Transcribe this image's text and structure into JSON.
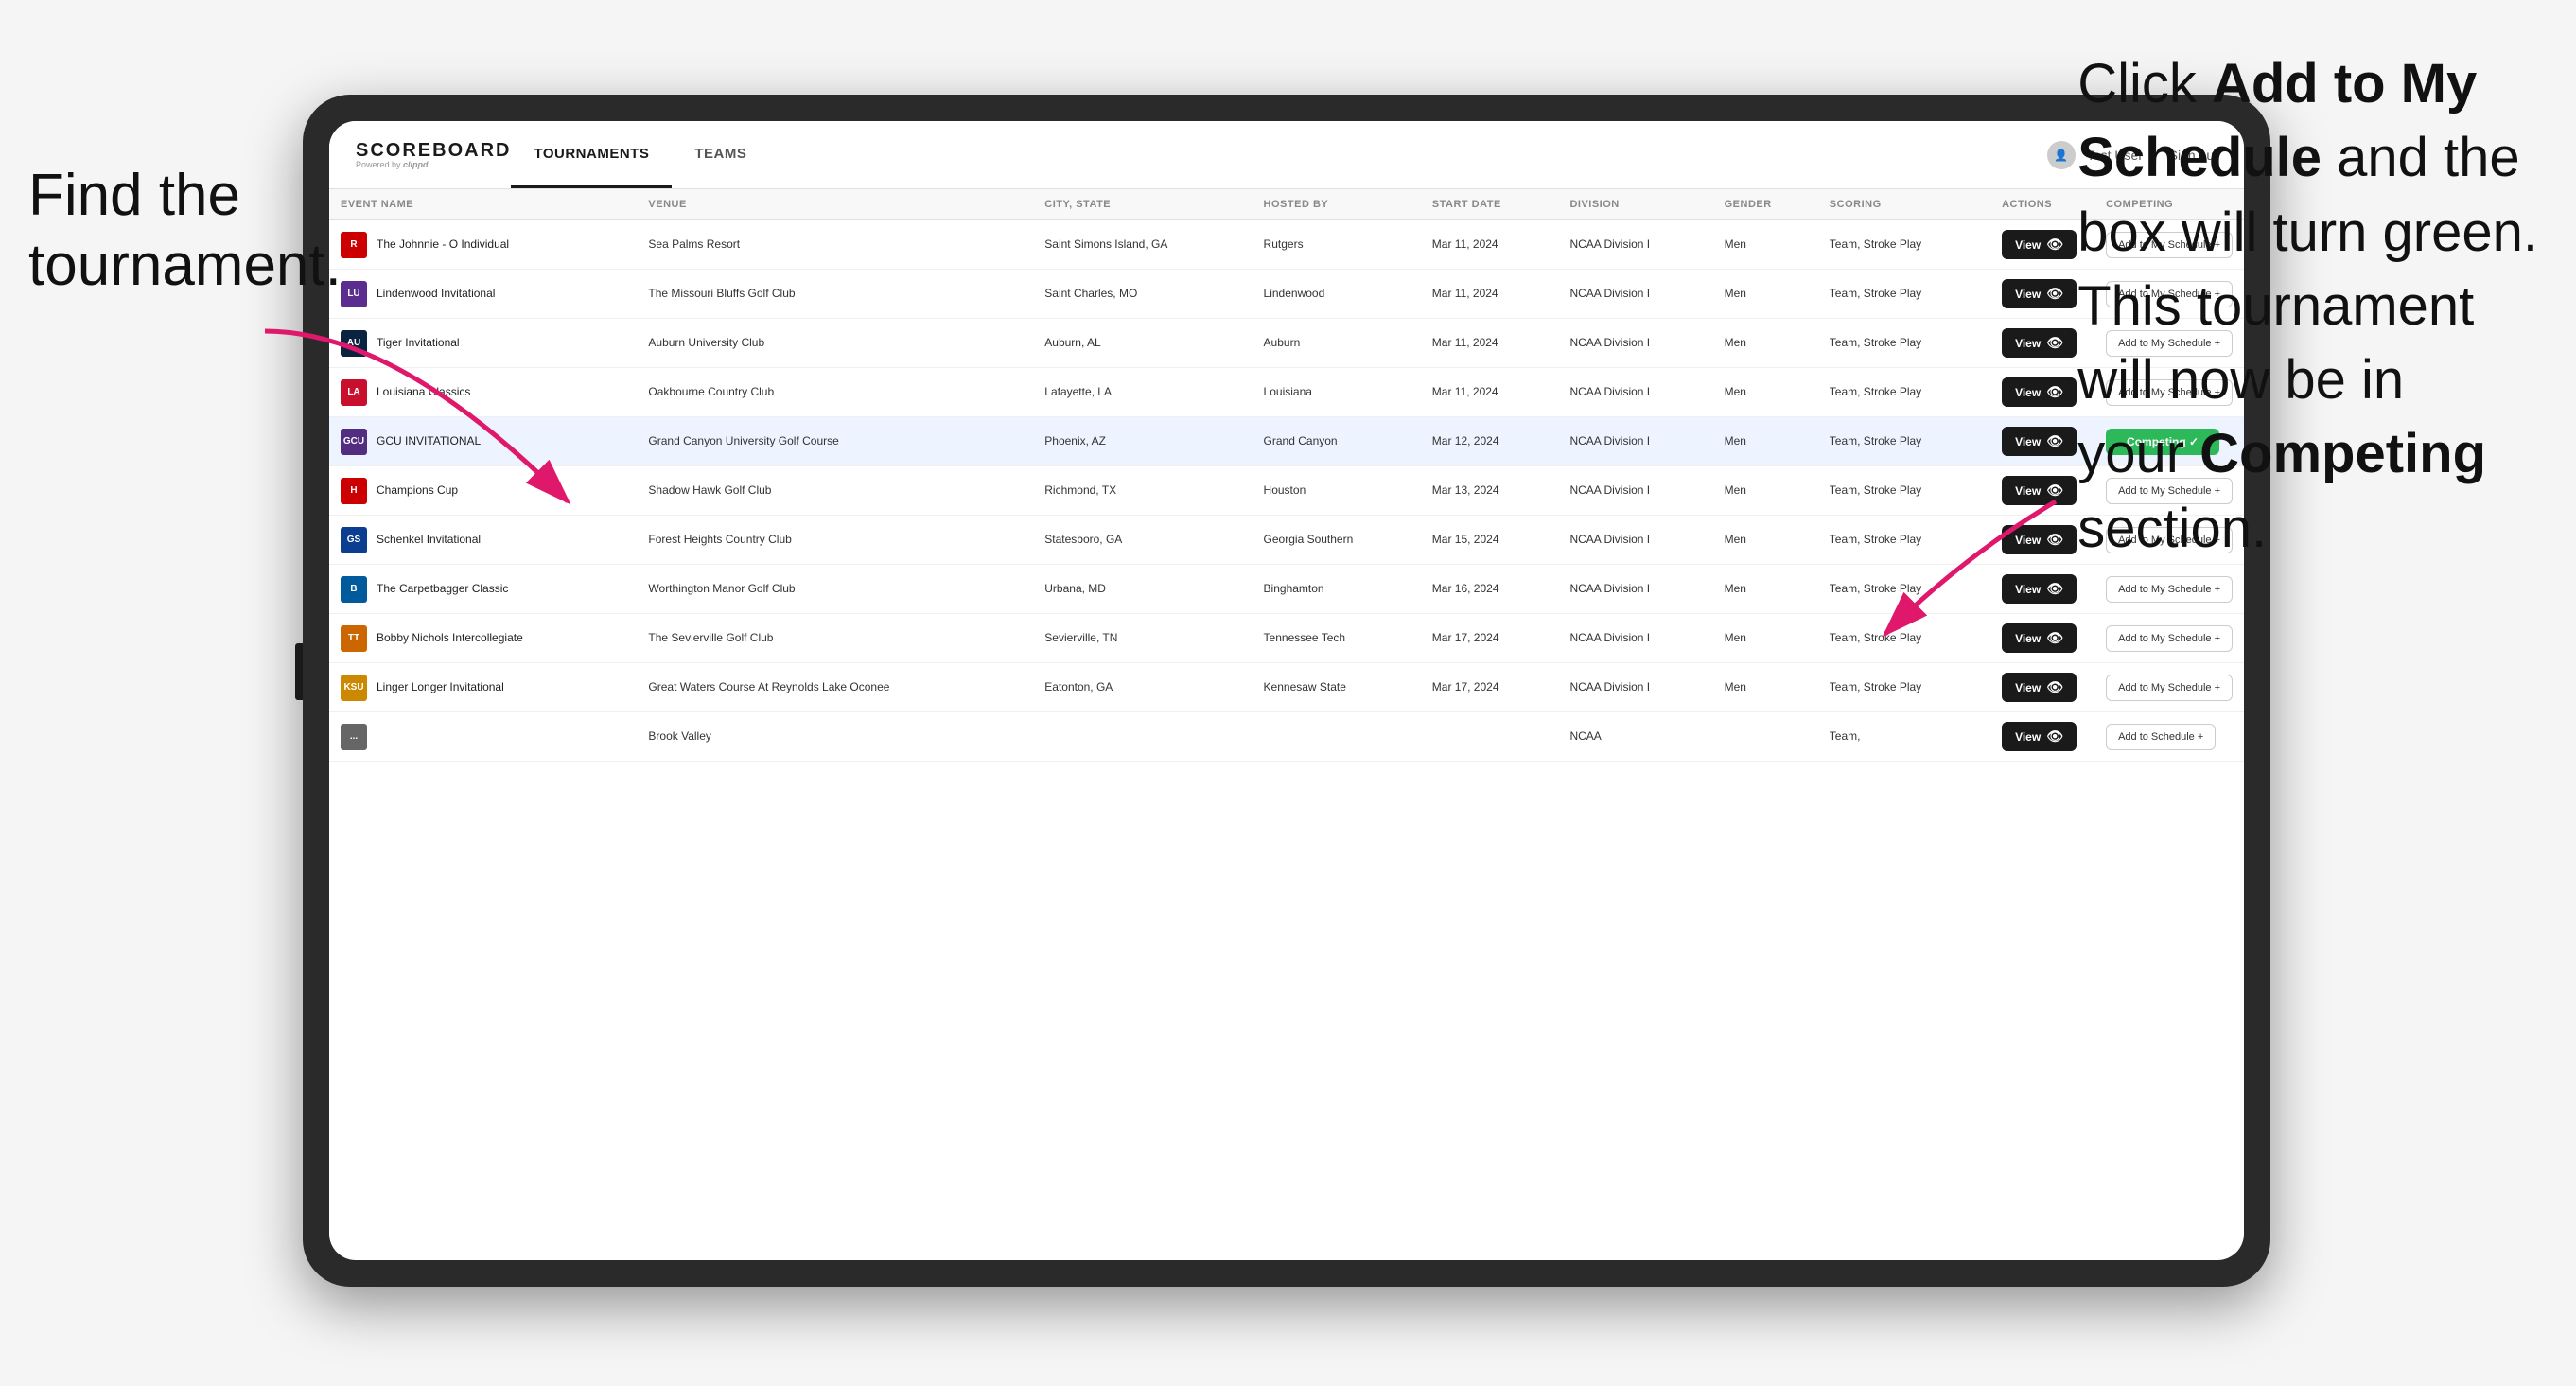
{
  "annotations": {
    "left": "Find the\ntournament.",
    "right_line1": "Click ",
    "right_bold1": "Add to My\nSchedule",
    "right_line2": " and the\nbox will turn green.\nThis tournament\nwill now be in\nyour ",
    "right_bold2": "Competing",
    "right_line3": "\nsection."
  },
  "app": {
    "logo": "SCOREBOARD",
    "logo_sub": "Powered by clippd",
    "nav": [
      "TOURNAMENTS",
      "TEAMS"
    ],
    "active_nav": "TOURNAMENTS",
    "user": "Test User",
    "signout": "Sign out"
  },
  "table": {
    "columns": [
      "EVENT NAME",
      "VENUE",
      "CITY, STATE",
      "HOSTED BY",
      "START DATE",
      "DIVISION",
      "GENDER",
      "SCORING",
      "ACTIONS",
      "COMPETING"
    ],
    "rows": [
      {
        "logo_text": "R",
        "logo_color": "#cc0000",
        "event": "The Johnnie - O Individual",
        "venue": "Sea Palms Resort",
        "city_state": "Saint Simons Island, GA",
        "hosted_by": "Rutgers",
        "start_date": "Mar 11, 2024",
        "division": "NCAA Division I",
        "gender": "Men",
        "scoring": "Team, Stroke Play",
        "action": "View",
        "competing_status": "add",
        "competing_label": "Add to My Schedule +"
      },
      {
        "logo_text": "LU",
        "logo_color": "#5b2d8e",
        "event": "Lindenwood Invitational",
        "venue": "The Missouri Bluffs Golf Club",
        "city_state": "Saint Charles, MO",
        "hosted_by": "Lindenwood",
        "start_date": "Mar 11, 2024",
        "division": "NCAA Division I",
        "gender": "Men",
        "scoring": "Team, Stroke Play",
        "action": "View",
        "competing_status": "add",
        "competing_label": "Add to My Schedule +"
      },
      {
        "logo_text": "AU",
        "logo_color": "#0c2340",
        "event": "Tiger Invitational",
        "venue": "Auburn University Club",
        "city_state": "Auburn, AL",
        "hosted_by": "Auburn",
        "start_date": "Mar 11, 2024",
        "division": "NCAA Division I",
        "gender": "Men",
        "scoring": "Team, Stroke Play",
        "action": "View",
        "competing_status": "add",
        "competing_label": "Add to My Schedule +"
      },
      {
        "logo_text": "LA",
        "logo_color": "#c8102e",
        "event": "Louisiana Classics",
        "venue": "Oakbourne Country Club",
        "city_state": "Lafayette, LA",
        "hosted_by": "Louisiana",
        "start_date": "Mar 11, 2024",
        "division": "NCAA Division I",
        "gender": "Men",
        "scoring": "Team, Stroke Play",
        "action": "View",
        "competing_status": "add",
        "competing_label": "Add to My Schedule +"
      },
      {
        "logo_text": "GCU",
        "logo_color": "#522d80",
        "event": "GCU INVITATIONAL",
        "venue": "Grand Canyon University Golf Course",
        "city_state": "Phoenix, AZ",
        "hosted_by": "Grand Canyon",
        "start_date": "Mar 12, 2024",
        "division": "NCAA Division I",
        "gender": "Men",
        "scoring": "Team, Stroke Play",
        "action": "View",
        "competing_status": "competing",
        "competing_label": "Competing ✓",
        "highlighted": true
      },
      {
        "logo_text": "H",
        "logo_color": "#cc0000",
        "event": "Champions Cup",
        "venue": "Shadow Hawk Golf Club",
        "city_state": "Richmond, TX",
        "hosted_by": "Houston",
        "start_date": "Mar 13, 2024",
        "division": "NCAA Division I",
        "gender": "Men",
        "scoring": "Team, Stroke Play",
        "action": "View",
        "competing_status": "add",
        "competing_label": "Add to My Schedule +"
      },
      {
        "logo_text": "GS",
        "logo_color": "#0b3d91",
        "event": "Schenkel Invitational",
        "venue": "Forest Heights Country Club",
        "city_state": "Statesboro, GA",
        "hosted_by": "Georgia Southern",
        "start_date": "Mar 15, 2024",
        "division": "NCAA Division I",
        "gender": "Men",
        "scoring": "Team, Stroke Play",
        "action": "View",
        "competing_status": "add",
        "competing_label": "Add to My Schedule +"
      },
      {
        "logo_text": "B",
        "logo_color": "#005a9c",
        "event": "The Carpetbagger Classic",
        "venue": "Worthington Manor Golf Club",
        "city_state": "Urbana, MD",
        "hosted_by": "Binghamton",
        "start_date": "Mar 16, 2024",
        "division": "NCAA Division I",
        "gender": "Men",
        "scoring": "Team, Stroke Play",
        "action": "View",
        "competing_status": "add",
        "competing_label": "Add to My Schedule +"
      },
      {
        "logo_text": "TT",
        "logo_color": "#cc6600",
        "event": "Bobby Nichols Intercollegiate",
        "venue": "The Sevierville Golf Club",
        "city_state": "Sevierville, TN",
        "hosted_by": "Tennessee Tech",
        "start_date": "Mar 17, 2024",
        "division": "NCAA Division I",
        "gender": "Men",
        "scoring": "Team, Stroke Play",
        "action": "View",
        "competing_status": "add",
        "competing_label": "Add to My Schedule +"
      },
      {
        "logo_text": "KSU",
        "logo_color": "#cc8800",
        "event": "Linger Longer Invitational",
        "venue": "Great Waters Course At Reynolds Lake Oconee",
        "city_state": "Eatonton, GA",
        "hosted_by": "Kennesaw State",
        "start_date": "Mar 17, 2024",
        "division": "NCAA Division I",
        "gender": "Men",
        "scoring": "Team, Stroke Play",
        "action": "View",
        "competing_status": "add",
        "competing_label": "Add to My Schedule +"
      },
      {
        "logo_text": "...",
        "logo_color": "#666",
        "event": "",
        "venue": "Brook Valley",
        "city_state": "",
        "hosted_by": "",
        "start_date": "",
        "division": "NCAA",
        "gender": "",
        "scoring": "Team,",
        "action": "View",
        "competing_status": "add",
        "competing_label": "Add to Schedule +"
      }
    ]
  }
}
